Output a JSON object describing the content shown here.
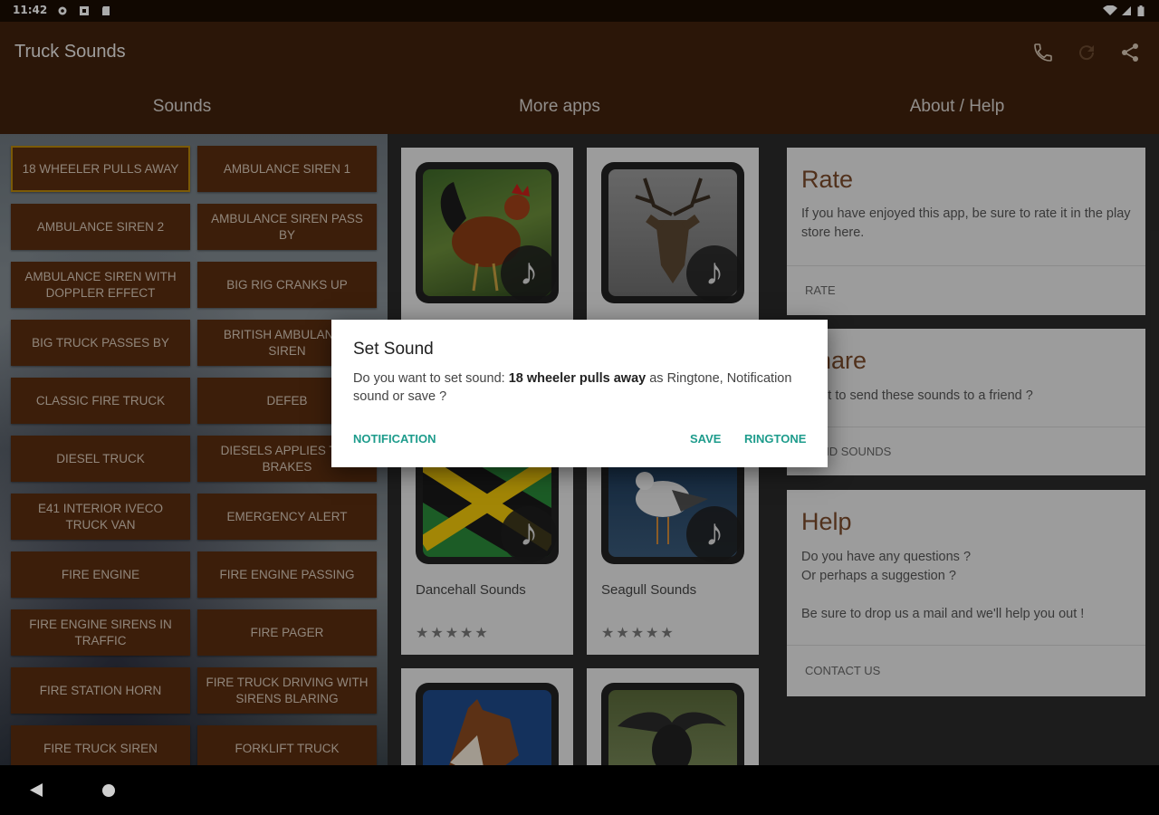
{
  "status_bar": {
    "time": "11:42"
  },
  "app": {
    "title": "Truck Sounds",
    "actions": [
      "phone-icon",
      "refresh-icon",
      "share-icon"
    ],
    "tabs": [
      "Sounds",
      "More apps",
      "About / Help"
    ]
  },
  "sounds": [
    "18 wheeler pulls away",
    "Ambulance siren 1",
    "Ambulance siren 2",
    "Ambulance siren pass by",
    "Ambulance siren with doppler effect",
    "Big rig cranks up",
    "Big truck passes by",
    "British ambulance siren",
    "Classic fire truck",
    "Defeb",
    "Diesel truck",
    "Diesels applies the brakes",
    "E41 Interior Iveco truck van",
    "Emergency alert",
    "Fire engine",
    "Fire engine passing",
    "Fire engine sirens in traffic",
    "Fire pager",
    "Fire station horn",
    "Fire truck driving with sirens blaring",
    "Fire truck siren",
    "Forklift truck"
  ],
  "more_apps": [
    {
      "name": "",
      "stars": "",
      "image": "rooster"
    },
    {
      "name": "",
      "stars": "",
      "image": "deer"
    },
    {
      "name": "Dancehall Sounds",
      "stars": "★★★★★",
      "image": "jamaica-flag"
    },
    {
      "name": "Seagull Sounds",
      "stars": "★★★★★",
      "image": "seagull"
    },
    {
      "name": "",
      "stars": "",
      "image": "horse"
    },
    {
      "name": "",
      "stars": "",
      "image": "buffalo"
    }
  ],
  "about": {
    "rate": {
      "title": "Rate",
      "body": "If you have enjoyed this app, be sure to rate it in the play store here.",
      "action": "Rate"
    },
    "share": {
      "title": "Share",
      "body": "Want to send these sounds to a friend ?",
      "action": "Send sounds"
    },
    "help": {
      "title": "Help",
      "line1": "Do you have any questions ?",
      "line2": "Or perhaps a suggestion ?",
      "line3": "Be sure to drop us a mail and we'll help you out !",
      "action": "Contact us"
    }
  },
  "dialog": {
    "title": "Set Sound",
    "msg_prefix": "Do you want to set sound: ",
    "msg_sound": "18 wheeler pulls away",
    "msg_suffix": " as Ringtone, Notification sound or save ?",
    "btn_notification": "Notification",
    "btn_save": "Save",
    "btn_ringtone": "Ringtone"
  },
  "colors": {
    "app_bar": "#40220c",
    "button": "#5a2d10",
    "accent": "#1e9c8c",
    "heading": "#7a4a2a"
  }
}
